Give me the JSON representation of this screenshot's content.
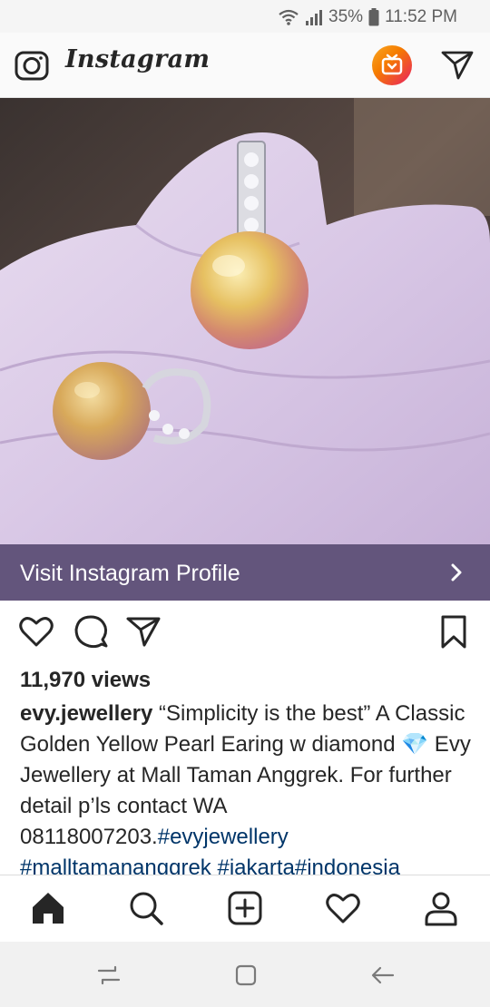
{
  "status_bar": {
    "battery": "35%",
    "time": "11:52 PM",
    "icons": [
      "wifi-icon",
      "signal-icon",
      "battery-icon"
    ]
  },
  "header": {
    "app_name": "Instagram",
    "icons": [
      "camera-icon",
      "igtv-icon",
      "direct-message-icon"
    ]
  },
  "post": {
    "image_alt": "Golden yellow pearl earrings with diamonds held on white gloved hand",
    "visit_profile_label": "Visit Instagram Profile",
    "views": "11,970 views",
    "username": "evy.jewellery",
    "caption_text": " “Simplicity is the best” A Classic Golden Yellow Pearl Earing w diamond 💎 Evy Jewellery at Mall Taman Anggrek. For further detail p’ls contact WA 08118007203.",
    "hashtags": [
      "#evyjewellery",
      "#malltamananggrek",
      "#jakarta",
      "#indonesia"
    ],
    "hashtag_separator_1": " ",
    "hashtag_separator_2": " ",
    "hashtag_separator_3": ""
  },
  "actions": [
    "like-icon",
    "comment-icon",
    "share-icon",
    "save-icon"
  ],
  "bottom_nav": [
    "home-icon",
    "search-icon",
    "new-post-icon",
    "activity-icon",
    "profile-icon"
  ],
  "android_nav": [
    "recent-apps-icon",
    "home-button-icon",
    "back-icon"
  ],
  "colors": {
    "visit_bar": "#63557c",
    "hashtag": "#003569",
    "text": "#262626"
  }
}
